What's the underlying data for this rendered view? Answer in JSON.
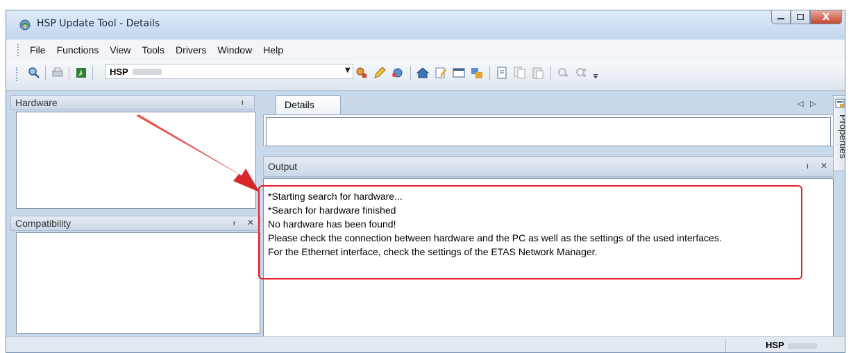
{
  "window": {
    "title": "HSP Update Tool - Details",
    "close_glyph": "X"
  },
  "menu": {
    "items": [
      "File",
      "Functions",
      "View",
      "Tools",
      "Drivers",
      "Window",
      "Help"
    ]
  },
  "toolbar": {
    "hsp_label": "HSP"
  },
  "panels": {
    "hardware_title": "Hardware",
    "compatibility_title": "Compatibility",
    "details_tab": "Details",
    "output_title": "Output",
    "properties_tab": "Properties"
  },
  "output": {
    "lines": [
      "*Starting search for hardware...",
      "*Search for hardware finished",
      "No hardware has been found!",
      "Please check the connection between hardware and the PC as well as the settings of the used interfaces.",
      "For the Ethernet interface, check the settings of the ETAS Network Manager."
    ]
  },
  "status": {
    "text": "HSP"
  },
  "colors": {
    "highlight": "#e8202a",
    "arrow": "#e8202a"
  }
}
